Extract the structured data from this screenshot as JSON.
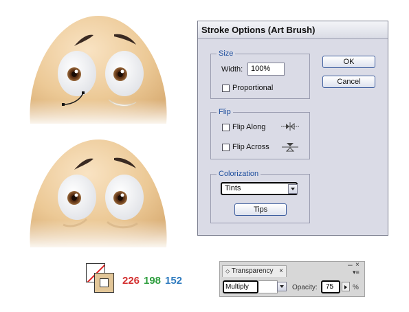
{
  "dialog": {
    "title": "Stroke Options (Art Brush)",
    "ok_label": "OK",
    "cancel_label": "Cancel",
    "size": {
      "legend": "Size",
      "width_label": "Width:",
      "width_value": "100%",
      "proportional_label": "Proportional",
      "proportional_checked": false
    },
    "flip": {
      "legend": "Flip",
      "flip_along_label": "Flip Along",
      "flip_along_checked": false,
      "flip_across_label": "Flip Across",
      "flip_across_checked": false
    },
    "colorization": {
      "legend": "Colorization",
      "method_value": "Tints",
      "tips_label": "Tips"
    }
  },
  "color": {
    "r": "226",
    "g": "198",
    "b": "152",
    "r_color": "#d32f2f",
    "g_color": "#2e9e3e",
    "b_color": "#2f7bbf",
    "fill_hex": "#e2c698"
  },
  "transparency": {
    "tab_label": "Transparency",
    "blend_mode": "Multiply",
    "opacity_label": "Opacity:",
    "opacity_value": "75",
    "percent": "%"
  }
}
